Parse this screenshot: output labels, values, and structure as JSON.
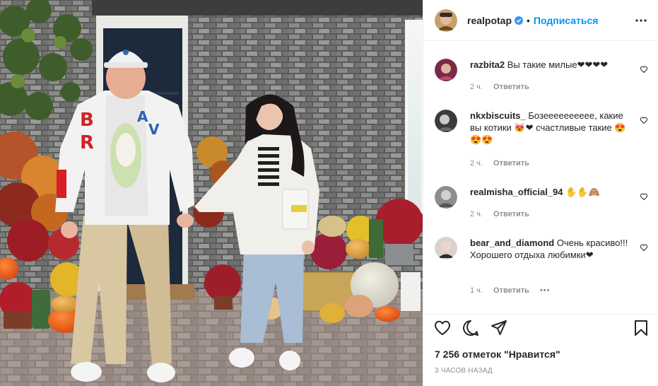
{
  "post": {
    "username": "realpotap",
    "follow_label": "Подписаться",
    "separator": "•",
    "more_icon": "more-horizontal-icon",
    "verified_icon": "verified-badge-icon"
  },
  "comments": [
    {
      "user": "razbita2",
      "text": "Вы такие милые❤❤❤❤",
      "time": "2 ч.",
      "reply": "Ответить"
    },
    {
      "user": "nkxbiscuits_",
      "text": "Бозееееееееее, какие вы котики 😻❤ счастливые такие 😍😍😍",
      "time": "2 ч.",
      "reply": "Ответить"
    },
    {
      "user": "realmisha_official_94",
      "text": "✋✋🙈",
      "time": "2 ч.",
      "reply": "Ответить"
    },
    {
      "user": "bear_and_diamond",
      "text": "Очень красиво!!! Хорошего отдыха любимки❤",
      "time": "1 ч.",
      "reply": "Ответить",
      "more": "•••"
    }
  ],
  "actions": {
    "like_icon": "heart-icon",
    "comment_icon": "comment-icon",
    "share_icon": "share-icon",
    "save_icon": "bookmark-icon"
  },
  "likes_text": "7 256 отметок \"Нравится\"",
  "timestamp": "3 часов назад",
  "colors": {
    "link": "#0095f6",
    "verified": "#3897f0",
    "meta_text": "#8e8e8e",
    "border": "#efefef"
  }
}
